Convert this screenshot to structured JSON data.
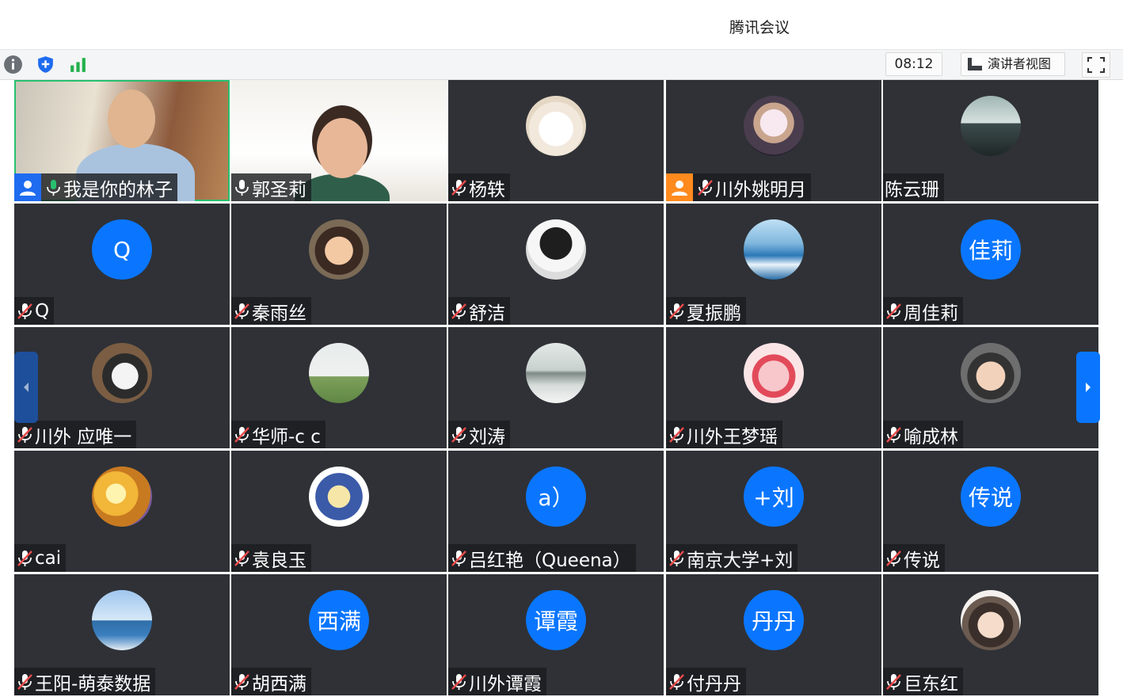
{
  "window": {
    "title": "腾讯会议"
  },
  "toolbar": {
    "info_icon": "info-icon",
    "shield_icon": "shield-icon",
    "signal_icon": "signal-icon",
    "timer": "08:12",
    "speaker_view_label": "演讲者视图",
    "fullscreen_icon": "fullscreen-icon"
  },
  "colors": {
    "avatar_blue": "#0a76ff",
    "tile_bg": "#2f3136",
    "active_border": "#27c06f",
    "nav_arrow": "#0a76ff",
    "muted_mic": "#e84a4a"
  },
  "participants": [
    {
      "name": "我是你的林子",
      "tile": "video",
      "mic": "active",
      "host": true
    },
    {
      "name": "郭圣莉",
      "tile": "video",
      "mic": "on"
    },
    {
      "name": "杨轶",
      "tile": "photo",
      "mic": "muted"
    },
    {
      "name": "川外姚明月",
      "tile": "photo",
      "mic": "muted",
      "cohost": true
    },
    {
      "name": "陈云珊",
      "tile": "photo",
      "mic": "none"
    },
    {
      "name": "Q",
      "tile": "text",
      "avatar_text": "Q",
      "mic": "muted"
    },
    {
      "name": "秦雨丝",
      "tile": "photo",
      "mic": "muted"
    },
    {
      "name": "舒洁",
      "tile": "photo",
      "mic": "muted"
    },
    {
      "name": "夏振鹏",
      "tile": "photo",
      "mic": "muted"
    },
    {
      "name": "周佳莉",
      "tile": "text",
      "avatar_text": "佳莉",
      "mic": "muted"
    },
    {
      "name": "川外 应唯一",
      "tile": "photo",
      "mic": "muted"
    },
    {
      "name": "华师-c c",
      "tile": "photo",
      "mic": "muted"
    },
    {
      "name": "刘涛",
      "tile": "photo",
      "mic": "muted"
    },
    {
      "name": "川外王梦瑶",
      "tile": "photo",
      "mic": "muted"
    },
    {
      "name": "喻成林",
      "tile": "photo",
      "mic": "muted"
    },
    {
      "name": "cai",
      "tile": "photo",
      "mic": "muted"
    },
    {
      "name": "袁良玉",
      "tile": "photo",
      "mic": "muted"
    },
    {
      "name": "吕红艳（Queena）",
      "tile": "text",
      "avatar_text": "a）",
      "mic": "muted"
    },
    {
      "name": "南京大学+刘",
      "tile": "text",
      "avatar_text": "+刘",
      "mic": "muted"
    },
    {
      "name": "传说",
      "tile": "text",
      "avatar_text": "传说",
      "mic": "muted"
    },
    {
      "name": "王阳-萌泰数据",
      "tile": "photo",
      "mic": "muted"
    },
    {
      "name": "胡西满",
      "tile": "text",
      "avatar_text": "西满",
      "mic": "muted"
    },
    {
      "name": "川外谭霞",
      "tile": "text",
      "avatar_text": "谭霞",
      "mic": "muted"
    },
    {
      "name": "付丹丹",
      "tile": "text",
      "avatar_text": "丹丹",
      "mic": "muted"
    },
    {
      "name": "巨东红",
      "tile": "photo",
      "mic": "muted"
    }
  ],
  "nav": {
    "prev_icon": "chevron-left-icon",
    "next_icon": "chevron-right-icon"
  }
}
